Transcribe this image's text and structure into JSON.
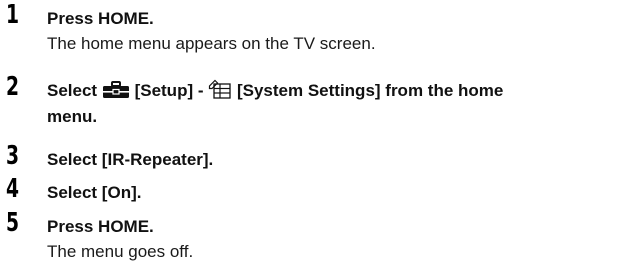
{
  "steps": [
    {
      "number": "1",
      "title": "Press HOME.",
      "description": "The home menu appears on the TV screen."
    },
    {
      "number": "2",
      "title_prefix": "Select",
      "setup_label": "[Setup] -",
      "system_label": "[System Settings] from the home",
      "title_line2": "menu.",
      "icons": [
        "toolbox-icon",
        "system-settings-icon"
      ]
    },
    {
      "number": "3",
      "title": "Select [IR-Repeater]."
    },
    {
      "number": "4",
      "title": "Select [On]."
    },
    {
      "number": "5",
      "title": "Press HOME.",
      "description": "The menu goes off."
    }
  ]
}
